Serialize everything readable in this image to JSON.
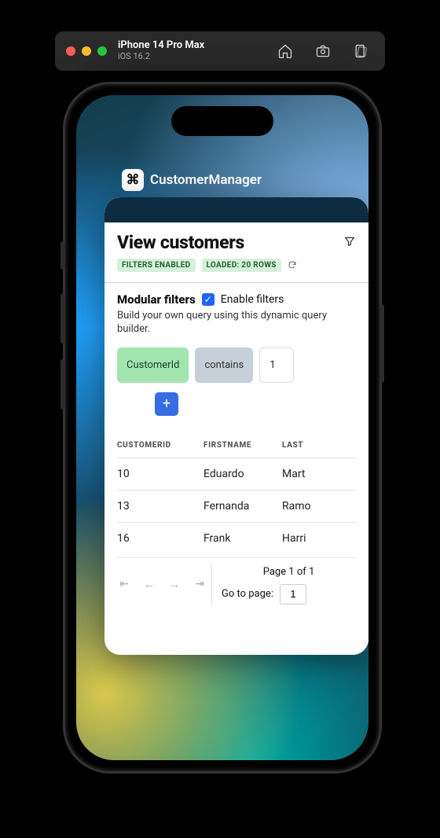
{
  "simulator": {
    "device": "iPhone 14 Pro Max",
    "os": "iOS 16.2"
  },
  "app": {
    "name": "CustomerManager",
    "icon_glyph": "⌘"
  },
  "page": {
    "title": "View customers",
    "badges": {
      "filters": "FILTERS ENABLED",
      "loaded": "LOADED: 20 ROWS"
    }
  },
  "modular_filters": {
    "heading": "Modular filters",
    "enable_label": "Enable filters",
    "enabled": true,
    "description": "Build your own query using this dynamic query builder.",
    "column": "CustomerId",
    "operator": "contains",
    "value": "1",
    "add_label": "+"
  },
  "table": {
    "columns": [
      "CUSTOMERID",
      "FIRSTNAME",
      "LASTNAME"
    ],
    "col_lastname_visible": "LAST",
    "rows": [
      {
        "id": "10",
        "first": "Eduardo",
        "last_visible": "Mart"
      },
      {
        "id": "13",
        "first": "Fernanda",
        "last_visible": "Ramo"
      },
      {
        "id": "16",
        "first": "Frank",
        "last_visible": "Harri"
      }
    ]
  },
  "pagination": {
    "page_info": "Page 1 of 1",
    "goto_label": "Go to page:",
    "goto_value": "1"
  }
}
